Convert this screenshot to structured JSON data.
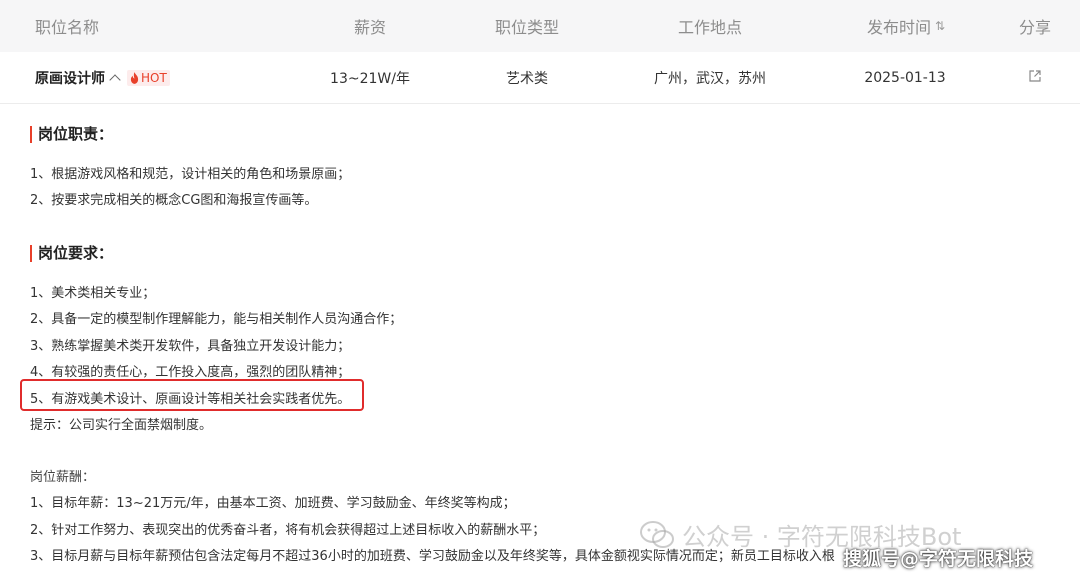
{
  "table": {
    "headers": {
      "name": "职位名称",
      "salary": "薪资",
      "type": "职位类型",
      "location": "工作地点",
      "date": "发布时间",
      "share": "分享"
    },
    "sort_glyph": "⇅",
    "row": {
      "name": "原画设计师",
      "hot": "HOT",
      "salary": "13~21W/年",
      "type": "艺术类",
      "location": "广州，武汉，苏州",
      "date": "2025-01-13"
    }
  },
  "duties": {
    "title": "岗位职责：",
    "items": [
      "1、根据游戏风格和规范，设计相关的角色和场景原画；",
      "2、按要求完成相关的概念CG图和海报宣传画等。"
    ]
  },
  "requirements": {
    "title": "岗位要求：",
    "items": [
      "1、美术类相关专业；",
      "2、具备一定的模型制作理解能力，能与相关制作人员沟通合作；",
      "3、熟练掌握美术类开发软件，具备独立开发设计能力；",
      "4、有较强的责任心，工作投入度高，强烈的团队精神；",
      "5、有游戏美术设计、原画设计等相关社会实践者优先。"
    ],
    "tip": "提示：公司实行全面禁烟制度。"
  },
  "compensation": {
    "title": "岗位薪酬：",
    "items": [
      "1、目标年薪：13~21万元/年，由基本工资、加班费、学习鼓励金、年终奖等构成；",
      "2、针对工作努力、表现突出的优秀奋斗者，将有机会获得超过上述目标收入的薪酬水平；",
      "3、目标月薪与目标年薪预估包含法定每月不超过36小时的加班费、学习鼓励金以及年终奖等，具体金额视实际情况而定；新员工目标收入根"
    ]
  },
  "watermarks": {
    "wechat": "公众号 · 字符无限科技Bot",
    "sohu": "搜狐号@字符无限科技"
  },
  "colors": {
    "accent": "#e8402a",
    "highlight_border": "#e02c2c",
    "header_bg": "#f6f6f7"
  },
  "icons": [
    "chevron-up-icon",
    "flame-icon",
    "sort-icon",
    "share-icon",
    "wechat-icon"
  ]
}
